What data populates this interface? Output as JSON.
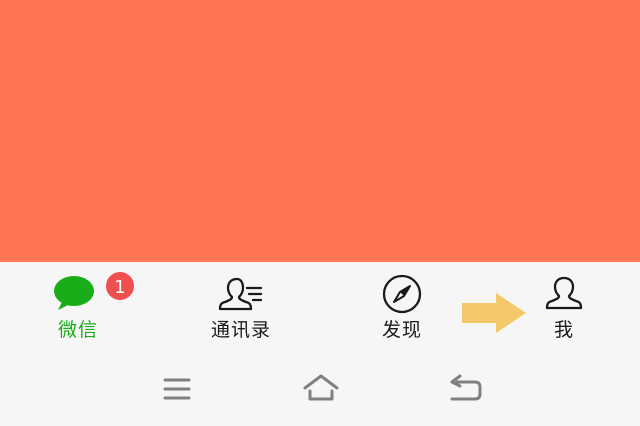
{
  "tabs": [
    {
      "id": "chats",
      "label": "微信",
      "icon": "chat-bubbles-icon",
      "active": true,
      "badge": "1"
    },
    {
      "id": "contacts",
      "label": "通讯录",
      "icon": "contacts-icon",
      "active": false
    },
    {
      "id": "discover",
      "label": "发现",
      "icon": "compass-icon",
      "active": false
    },
    {
      "id": "me",
      "label": "我",
      "icon": "person-icon",
      "active": false
    }
  ],
  "nav_bar": {
    "buttons": [
      "menu-icon",
      "home-icon",
      "back-icon"
    ]
  },
  "colors": {
    "content_background": "#fe7656",
    "accent": "#1aad19",
    "badge": "#ef4f4f",
    "hint_arrow": "#f3c96b"
  }
}
